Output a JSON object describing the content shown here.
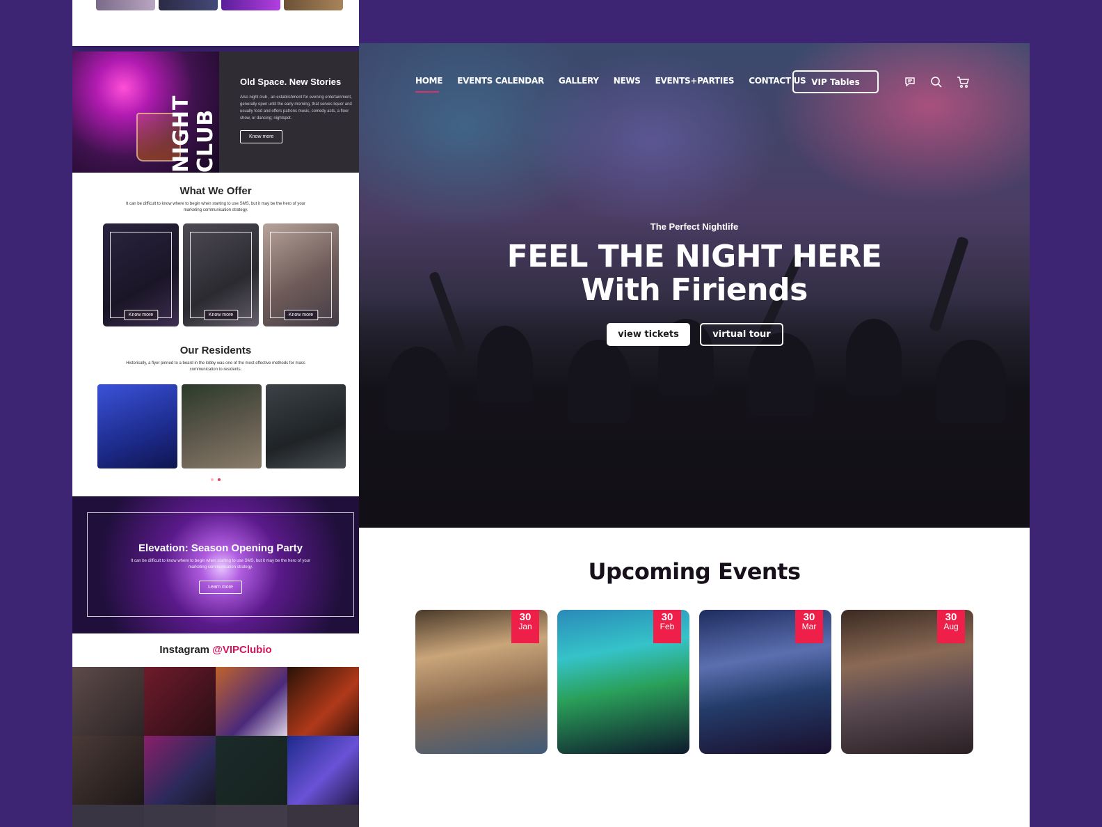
{
  "colors": {
    "page_bg": "#3d2573",
    "accent": "#ee1f48",
    "nav_active_underline": "#e0306a",
    "instagram_handle": "#d4145a"
  },
  "night_club": {
    "side_label": "NIGHT CLUB",
    "title": "Old Space. New Stories",
    "body": "Also night club , an establishment for evening entertainment, generally open until the early morning, that serves liquor and usually food and offers patrons music, comedy acts, a floor show, or dancing; nightspot.",
    "button": "Know more"
  },
  "offer": {
    "title": "What We Offer",
    "subtitle": "It can be difficult to know where to begin when starting to use SMS, but it may be the hero of your marketing communication strategy.",
    "cards": [
      {
        "button": "Know more"
      },
      {
        "button": "Know more"
      },
      {
        "button": "Know more"
      }
    ]
  },
  "residents": {
    "title": "Our Residents",
    "subtitle": "Historically, a flyer pinned to a board in the lobby was one of the most effective methods for mass communication to residents."
  },
  "party": {
    "title": "Elevation: Season Opening Party",
    "subtitle": "It can be difficult to know where to begin when starting to use SMS, but it may be the hero of your marketing communication strategy.",
    "button": "Learn more"
  },
  "instagram": {
    "label": "Instagram",
    "handle": "@VIPClubio"
  },
  "nav": {
    "items": [
      "HOME",
      "EVENTS CALENDAR",
      "GALLERY",
      "NEWS",
      "EVENTS+PARTIES",
      "CONTACT US"
    ],
    "active": "HOME",
    "vip_button": "VIP Tables",
    "icons": [
      "chat-icon",
      "search-icon",
      "cart-icon"
    ]
  },
  "hero": {
    "kicker": "The Perfect Nightlife",
    "title_line1": "FEEL THE NIGHT HERE",
    "title_line2": "With Firiends",
    "primary_button": "view tickets",
    "secondary_button": "virtual tour"
  },
  "events": {
    "title": "Upcoming Events",
    "items": [
      {
        "day": "30",
        "month": "Jan"
      },
      {
        "day": "30",
        "month": "Feb"
      },
      {
        "day": "30",
        "month": "Mar"
      },
      {
        "day": "30",
        "month": "Aug"
      }
    ]
  }
}
